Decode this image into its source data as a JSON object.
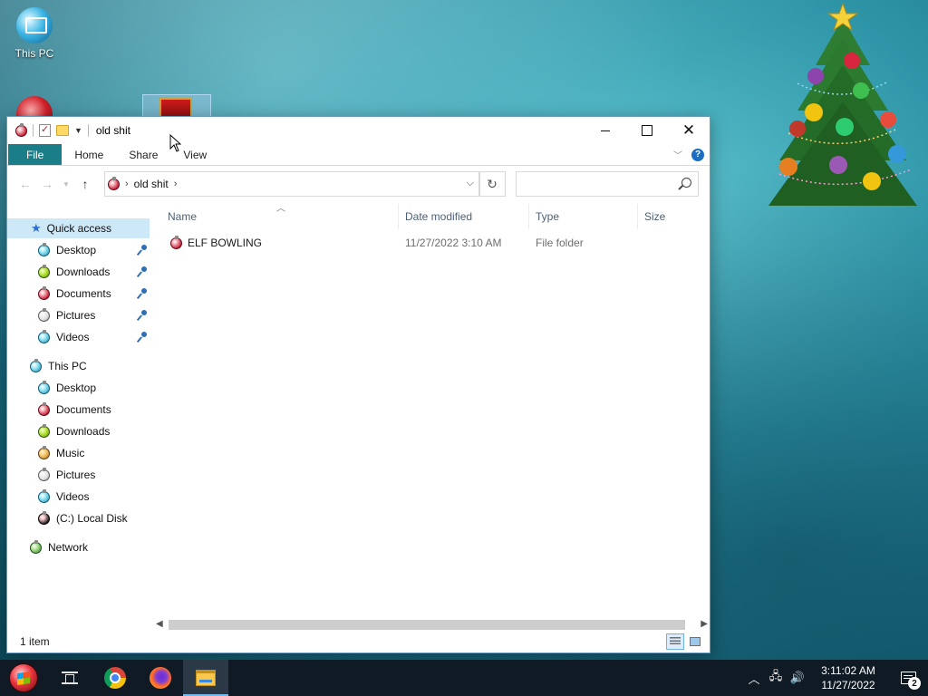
{
  "desktop": {
    "icons": [
      {
        "label": "This PC"
      }
    ]
  },
  "window": {
    "title": "old shit",
    "caption": {
      "minimize": "minimize",
      "maximize": "maximize",
      "close": "✕"
    }
  },
  "ribbon": {
    "tabs": [
      "File",
      "Home",
      "Share",
      "View"
    ],
    "help": "?"
  },
  "address": {
    "crumbs": [
      "old shit"
    ],
    "search_placeholder": ""
  },
  "nav_pane": {
    "quick_access": {
      "label": "Quick access",
      "items": [
        {
          "label": "Desktop",
          "icon": "ornament-blue-icon",
          "pinned": true
        },
        {
          "label": "Downloads",
          "icon": "ornament-green-icon",
          "pinned": true
        },
        {
          "label": "Documents",
          "icon": "ornament-red-icon",
          "pinned": true
        },
        {
          "label": "Pictures",
          "icon": "ornament-white-icon",
          "pinned": true
        },
        {
          "label": "Videos",
          "icon": "ornament-blue-icon",
          "pinned": true
        }
      ]
    },
    "this_pc": {
      "label": "This PC",
      "items": [
        {
          "label": "Desktop",
          "icon": "ornament-blue-icon"
        },
        {
          "label": "Documents",
          "icon": "ornament-red-icon"
        },
        {
          "label": "Downloads",
          "icon": "ornament-green-icon"
        },
        {
          "label": "Music",
          "icon": "ornament-orange-icon"
        },
        {
          "label": "Pictures",
          "icon": "ornament-white-icon"
        },
        {
          "label": "Videos",
          "icon": "ornament-blue-icon"
        },
        {
          "label": "(C:) Local Disk",
          "icon": "ornament-dark-icon"
        }
      ]
    },
    "network": {
      "label": "Network"
    }
  },
  "file_list": {
    "columns": [
      "Name",
      "Date modified",
      "Type",
      "Size"
    ],
    "rows": [
      {
        "name": "ELF BOWLING",
        "date_modified": "11/27/2022 3:10 AM",
        "type": "File folder",
        "size": ""
      }
    ]
  },
  "status_bar": {
    "item_count": "1 item"
  },
  "taskbar": {
    "pinned": [
      "start-button",
      "task-view",
      "chrome",
      "firefox",
      "file-explorer"
    ],
    "clock": {
      "time": "3:11:02 AM",
      "date": "11/27/2022"
    },
    "notification_count": "2"
  }
}
